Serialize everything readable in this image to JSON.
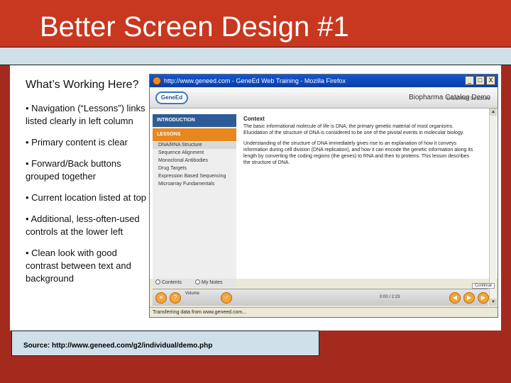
{
  "slide": {
    "title": "Better Screen Design #1",
    "heading": "What’s Working Here?",
    "bullets": [
      "• Navigation (“Lessons”) links listed clearly in left column",
      "• Primary content is clear",
      "• Forward/Back buttons grouped together",
      "• Current location listed at top",
      "• Additional, less-often-used controls at the lower left",
      "• Clean look with good contrast between text and background"
    ],
    "source": "Source: http://www.geneed.com/g2/individual/demo.php",
    "colors": {
      "band": "#c8371f",
      "background": "#a52a1e",
      "rule": "#cfe0e8"
    }
  },
  "browser": {
    "window_title": "http://www.geneed.com - GeneEd Web Training - Mozilla Firefox",
    "window_buttons": [
      "_",
      "□",
      "X"
    ],
    "logo": "GeneEd",
    "app_title": "Biopharma Catalog Demo",
    "breadcrumb": "DNA/RNA Structure",
    "nav_intro": "INTRODUCTION",
    "nav_lessons": "LESSONS",
    "nav_items": [
      "DNA/RNA Structure",
      "Sequence Alignment",
      "Monoclonal Antibodies",
      "Drug Targets",
      "Expression Based Sequencing",
      "Microarray Fundamentals"
    ],
    "content_heading": "Context",
    "content_p1": "The basic informational molecule of life is DNA, the primary genetic material of most organisms. Elucidation of the structure of DNA is considered to be one of the pivotal events in molecular biology.",
    "content_p2": "Understanding of the structure of DNA immediately gives rise to an explanation of how it conveys information during cell division (DNA replication), and how it can encode the genetic information along its length by converting the coding regions (the genes) to RNA and then to proteins. This lesson describes the structure of DNA.",
    "tab_contents": "Contents",
    "tab_notes": "My Notes",
    "volume_label": "Volume",
    "time": "0:00 / 2:23",
    "continue": "Continue",
    "status": "Transferring data from www.geneed.com..."
  }
}
